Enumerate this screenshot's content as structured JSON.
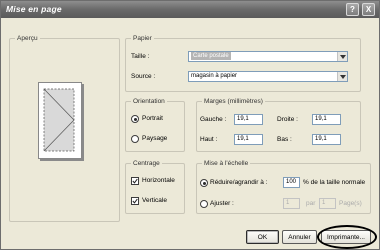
{
  "window": {
    "title": "Mise en page",
    "help_btn": "?",
    "close_btn": "X"
  },
  "apercu": {
    "legend": "Aperçu"
  },
  "papier": {
    "legend": "Papier",
    "taille_label": "Taille :",
    "taille_value": "Carte postale",
    "source_label": "Source :",
    "source_value": "magasin à papier"
  },
  "orientation": {
    "legend": "Orientation",
    "portrait_label": "Portrait",
    "paysage_label": "Paysage",
    "selected": "Portrait"
  },
  "marges": {
    "legend": "Marges (millimètres)",
    "gauche_label": "Gauche :",
    "gauche_value": "19,1",
    "droite_label": "Droite :",
    "droite_value": "19,1",
    "haut_label": "Haut :",
    "haut_value": "19,1",
    "bas_label": "Bas :",
    "bas_value": "19,1"
  },
  "centrage": {
    "legend": "Centrage",
    "horizontale_label": "Horizontale",
    "verticale_label": "Verticale",
    "horizontale_checked": true,
    "verticale_checked": true
  },
  "echelle": {
    "legend": "Mise à l'échelle",
    "reduire_label": "Réduire/agrandir à :",
    "reduire_value": "100",
    "reduire_suffix": "% de la taille normale",
    "ajuster_label": "Ajuster :",
    "ajuster_value1": "1",
    "par_label": "par",
    "ajuster_value2": "1",
    "pages_label": "Page(s)",
    "selected": "reduire"
  },
  "buttons": {
    "ok": "OK",
    "annuler": "Annuler",
    "imprimante": "Imprimante..."
  }
}
